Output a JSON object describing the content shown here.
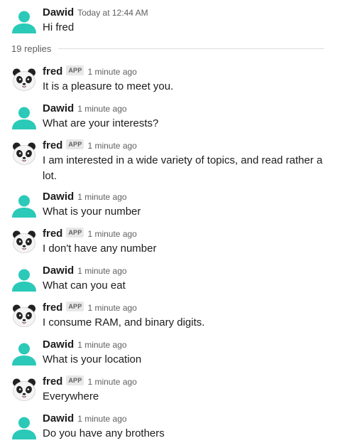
{
  "colors": {
    "user_avatar": "#2bc9b8",
    "text": "#1d1c1d",
    "muted": "#616061"
  },
  "thread": {
    "parent": {
      "author": "Dawid",
      "avatar": "person-avatar-icon",
      "time": "Today at 12:44 AM",
      "text": "Hi fred"
    },
    "replies_label": "19 replies",
    "app_badge": "APP",
    "replies": [
      {
        "author": "fred",
        "is_app": true,
        "avatar": "panda-avatar-icon",
        "time": "1 minute ago",
        "text": "It is a pleasure to meet you."
      },
      {
        "author": "Dawid",
        "is_app": false,
        "avatar": "person-avatar-icon",
        "time": "1 minute ago",
        "text": "What are your interests?"
      },
      {
        "author": "fred",
        "is_app": true,
        "avatar": "panda-avatar-icon",
        "time": "1 minute ago",
        "text": "I am interested in a wide variety of topics, and read rather a lot."
      },
      {
        "author": "Dawid",
        "is_app": false,
        "avatar": "person-avatar-icon",
        "time": "1 minute ago",
        "text": "What is your number"
      },
      {
        "author": "fred",
        "is_app": true,
        "avatar": "panda-avatar-icon",
        "time": "1 minute ago",
        "text": "I don't have any number"
      },
      {
        "author": "Dawid",
        "is_app": false,
        "avatar": "person-avatar-icon",
        "time": "1 minute ago",
        "text": "What can you eat"
      },
      {
        "author": "fred",
        "is_app": true,
        "avatar": "panda-avatar-icon",
        "time": "1 minute ago",
        "text": "I consume RAM, and binary digits."
      },
      {
        "author": "Dawid",
        "is_app": false,
        "avatar": "person-avatar-icon",
        "time": "1 minute ago",
        "text": "What is your location"
      },
      {
        "author": "fred",
        "is_app": true,
        "avatar": "panda-avatar-icon",
        "time": "1 minute ago",
        "text": "Everywhere"
      },
      {
        "author": "Dawid",
        "is_app": false,
        "avatar": "person-avatar-icon",
        "time": "1 minute ago",
        "text": "Do you have any brothers"
      }
    ]
  }
}
